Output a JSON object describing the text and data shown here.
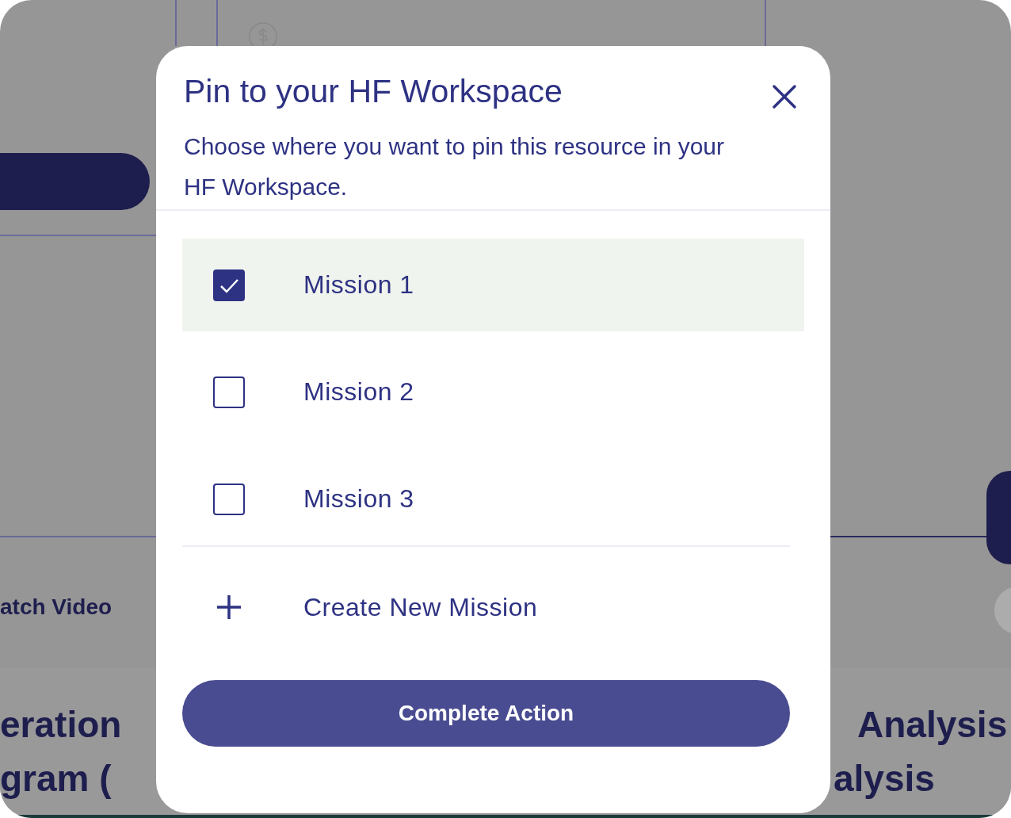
{
  "background": {
    "video_link": "atch Video",
    "card_titles": [
      {
        "lines": [
          "eration",
          "gram ("
        ]
      },
      {
        "lines": [
          "Analysis",
          "alysis"
        ]
      }
    ]
  },
  "dialog": {
    "title": "Pin to your HF Workspace",
    "description": "Choose where you want to pin this resource in your HF Workspace.",
    "missions": [
      {
        "label": "Mission 1",
        "checked": true
      },
      {
        "label": "Mission 2",
        "checked": false
      },
      {
        "label": "Mission 3",
        "checked": false
      }
    ],
    "create_label": "Create New Mission",
    "submit": "Complete Action"
  }
}
